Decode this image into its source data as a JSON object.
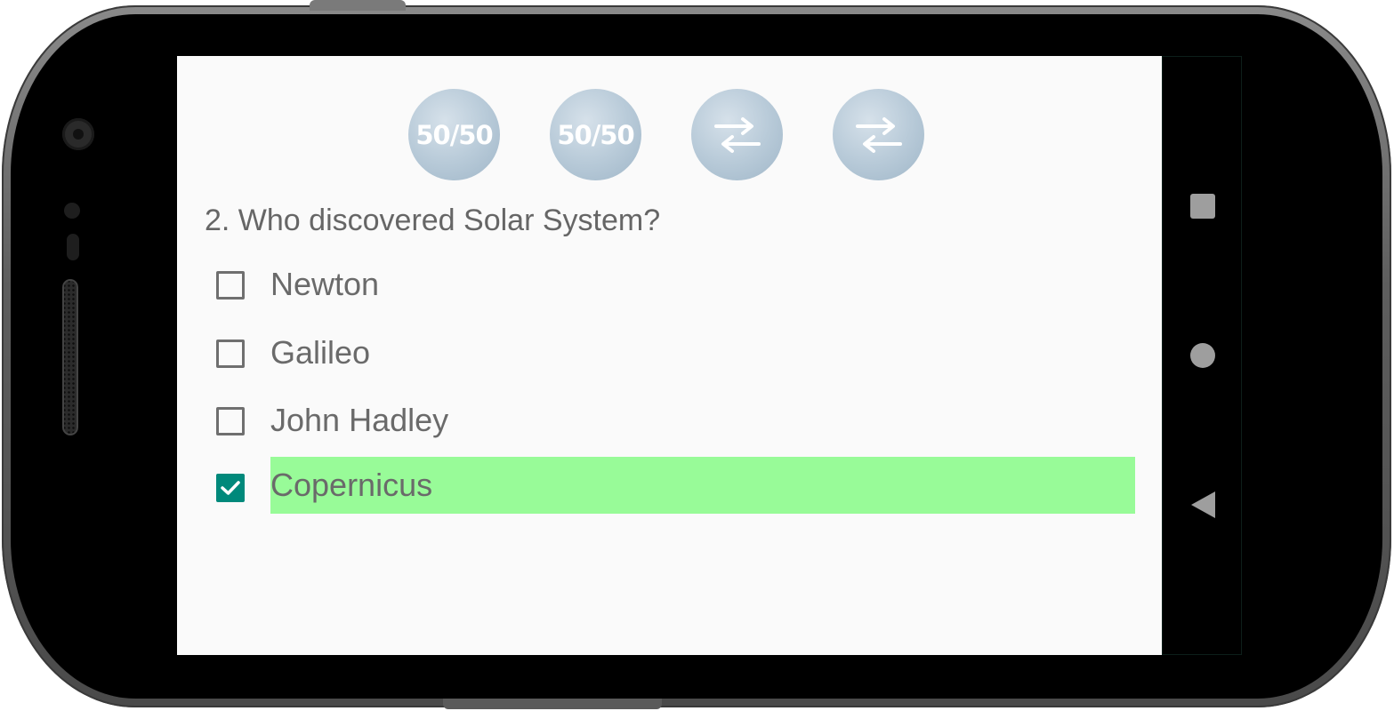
{
  "lifelines": [
    {
      "type": "fifty-fifty",
      "label": "50/50"
    },
    {
      "type": "fifty-fifty",
      "label": "50/50"
    },
    {
      "type": "swap-question",
      "icon": "swap-arrows-icon"
    },
    {
      "type": "swap-question",
      "icon": "swap-arrows-icon"
    }
  ],
  "question": {
    "text": "2. Who discovered Solar System?"
  },
  "options": [
    {
      "label": "Newton",
      "checked": false
    },
    {
      "label": "Galileo",
      "checked": false
    },
    {
      "label": "John Hadley",
      "checked": false
    },
    {
      "label": "Copernicus",
      "checked": true,
      "highlight_color": "#98fb98"
    }
  ],
  "colors": {
    "screen_bg": "#fafafa",
    "text": "#666666",
    "checkbox_checked": "#00897b",
    "correct_highlight": "#98fb98",
    "lifeline_bubble": "#b9cbd9"
  },
  "navigation": {
    "recents_icon": "square-icon",
    "home_icon": "circle-icon",
    "back_icon": "triangle-back-icon"
  }
}
